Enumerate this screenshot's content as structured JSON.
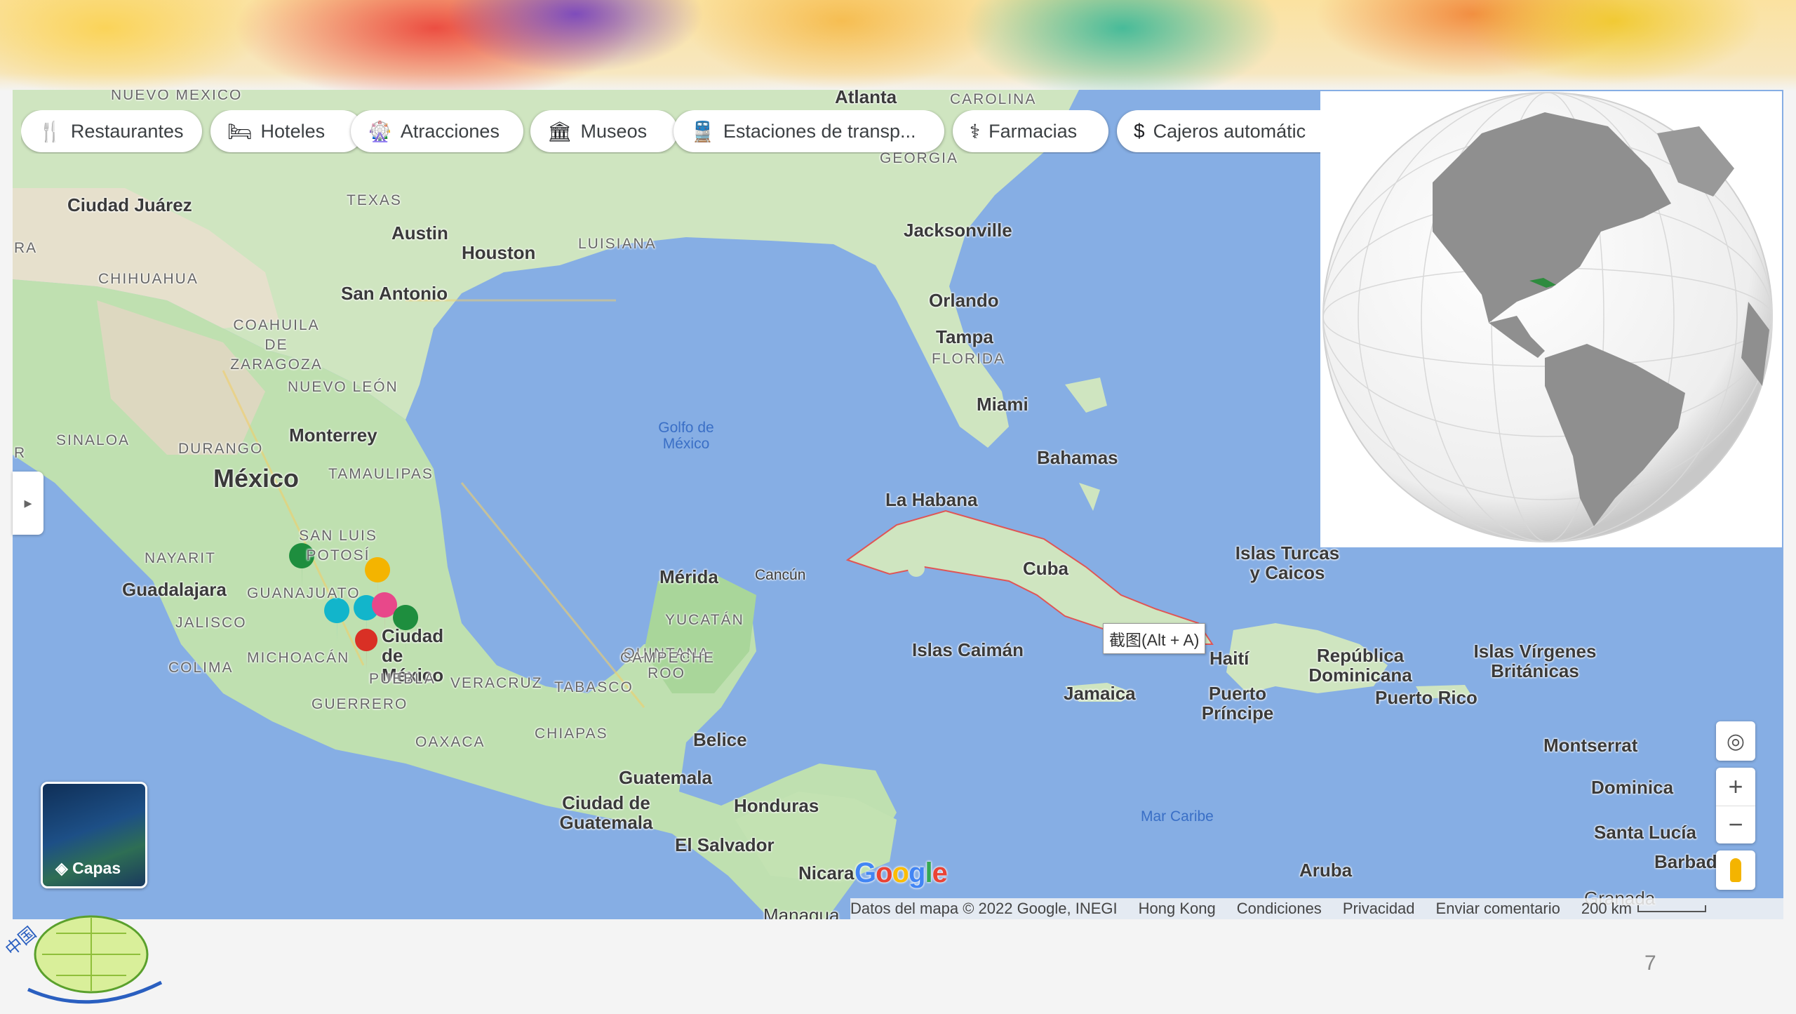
{
  "chips": [
    {
      "label": "Restaurantes",
      "icon": "fork-knife-icon",
      "glyph": "🍴"
    },
    {
      "label": "Hoteles",
      "icon": "bed-icon",
      "glyph": "🛏"
    },
    {
      "label": "Atracciones",
      "icon": "ferris-wheel-icon",
      "glyph": "🎡"
    },
    {
      "label": "Museos",
      "icon": "museum-icon",
      "glyph": "🏛"
    },
    {
      "label": "Estaciones de transp...",
      "icon": "train-icon",
      "glyph": "🚆"
    },
    {
      "label": "Farmacias",
      "icon": "pharmacy-icon",
      "glyph": "⚕"
    },
    {
      "label": "Cajeros automátic",
      "icon": "atm-icon",
      "glyph": "$"
    }
  ],
  "places": {
    "nuevo_mexico": "NUEVO MÉXICO",
    "texas": "TEXAS",
    "georgia": "GEORGIA",
    "carolina": "CAROLINA",
    "luisiana": "LUISIANA",
    "florida": "FLORIDA",
    "chihuahua": "CHIHUAHUA",
    "coahuila": "COAHUILA DE ZARAGOZA",
    "nuevo_leon": "NUEVO LEÓN",
    "sinaloa": "SINALOA",
    "durango": "DURANGO",
    "tamaulipas": "TAMAULIPAS",
    "san_luis": "SAN LUIS POTOSÍ",
    "nayarit": "NAYARIT",
    "guanajuato": "GUANAJUATO",
    "jalisco": "JALISCO",
    "colima": "COLIMA",
    "michoacan": "MICHOACÁN",
    "guerrero": "GUERRERO",
    "puebla": "PUEBLA",
    "veracruz": "VERACRUZ",
    "oaxaca": "OAXACA",
    "tabasco": "TABASCO",
    "chiapas": "CHIAPAS",
    "campeche": "CAMPECHE",
    "yucatan": "YUCATÁN",
    "quintana_roo": "QUINTANA ROO",
    "ra_left": "RA",
    "r_left": "R",
    "atlanta": "Atlanta",
    "ciudad_juarez": "Ciudad Juárez",
    "austin": "Austin",
    "houston": "Houston",
    "san_antonio": "San Antonio",
    "jacksonville": "Jacksonville",
    "orlando": "Orlando",
    "tampa": "Tampa",
    "miami": "Miami",
    "bahamas": "Bahamas",
    "monterrey": "Monterrey",
    "mexico": "México",
    "guadalajara": "Guadalajara",
    "ciudad_de_mexico": "Ciudad de México",
    "merida": "Mérida",
    "cancun": "Cancún",
    "la_habana": "La Habana",
    "cuba": "Cuba",
    "islas_caiman": "Islas Caimán",
    "jamaica": "Jamaica",
    "haiti": "Haití",
    "puerto_principe": "Puerto Príncipe",
    "republica_dominicana": "República Dominicana",
    "puerto_rico": "Puerto Rico",
    "islas_turcas": "Islas Turcas y Caicos",
    "islas_virgenes": "Islas Vírgenes Británicas",
    "montserrat": "Montserrat",
    "dominica": "Dominica",
    "santa_lucia": "Santa Lucía",
    "barbados": "Barbad",
    "aruba": "Aruba",
    "grenada": "Granada",
    "belice": "Belice",
    "guatemala": "Guatemala",
    "ciudad_guatemala": "Ciudad de Guatemala",
    "honduras": "Honduras",
    "el_salvador": "El Salvador",
    "nicaragua": "Nicara",
    "managua": "Managua",
    "golfo": "Golfo de México",
    "mar_caribe": "Mar Caribe"
  },
  "tooltip": "截图(Alt + A)",
  "google_logo": "Google",
  "layers_label": "Capas",
  "attribution": {
    "data": "Datos del mapa © 2022 Google, INEGI",
    "region": "Hong Kong",
    "terms": "Condiciones",
    "privacy": "Privacidad",
    "feedback": "Enviar comentario",
    "scale": "200 km"
  },
  "controls": {
    "zoom_in": "+",
    "zoom_out": "−"
  },
  "page_number": "7",
  "logo_text": "中国",
  "colors": {
    "sea": "#86aee4",
    "land": "#cde7bf",
    "highlight_country": "#2e8b3e",
    "cuba_border": "#e05555"
  }
}
